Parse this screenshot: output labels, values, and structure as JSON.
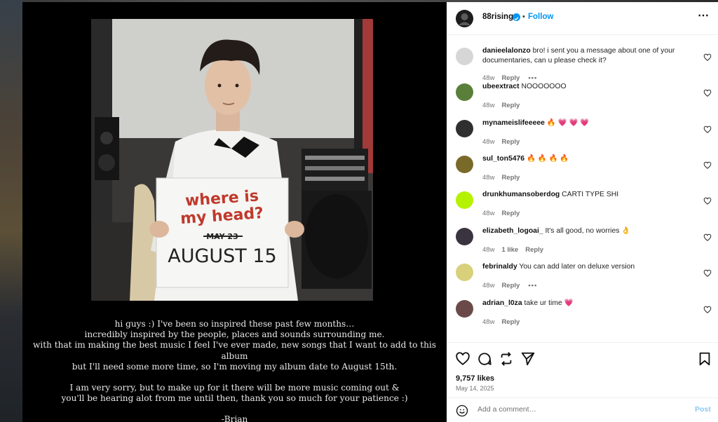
{
  "post": {
    "image_caption_lines": [
      "hi guys :) I've been so inspired these past few months…",
      "incredibly inspired by the people, places and sounds surrounding me.",
      "with that im making the best music I feel I've ever made, new songs that I want to add to this album",
      "but I'll need some more time, so I'm moving my album date to August 15th.",
      "",
      "I am very sorry, but to make up for it there will be more music coming out &",
      "you'll be hearing alot from me until then, thank you so much for your patience :)",
      "",
      "-Brian"
    ],
    "sign": {
      "title_line1": "where is",
      "title_line2": "my head?",
      "old_date": "MAY 23",
      "new_date": "AUGUST 15"
    }
  },
  "header": {
    "username": "88rising",
    "separator": "•",
    "follow_label": "Follow",
    "more_icon": "⋯"
  },
  "comments": [
    {
      "user": "danieelalonzo",
      "text": "bro! i sent you a message about one of your documentaries, can u please check it?",
      "time": "48w",
      "reply": "Reply",
      "likes": "",
      "more": "•••"
    },
    {
      "user": "ubeextract",
      "text": "NOOOOOOO",
      "time": "48w",
      "reply": "Reply",
      "likes": "",
      "more": ""
    },
    {
      "user": "mynameislifeeeee",
      "text": "🔥 💗 💗 💗",
      "time": "48w",
      "reply": "Reply",
      "likes": "",
      "more": ""
    },
    {
      "user": "sul_ton5476",
      "text": "🔥 🔥 🔥 🔥",
      "time": "48w",
      "reply": "Reply",
      "likes": "",
      "more": ""
    },
    {
      "user": "drunkhumansoberdog",
      "text": "CARTI TYPE SHI",
      "time": "48w",
      "reply": "Reply",
      "likes": "",
      "more": ""
    },
    {
      "user": "elizabeth_logoai_",
      "text": "It's all good, no worries 👌",
      "time": "48w",
      "reply": "Reply",
      "likes": "1 like",
      "more": ""
    },
    {
      "user": "febrinaldy",
      "text": "You can add later on deluxe version",
      "time": "48w",
      "reply": "Reply",
      "likes": "",
      "more": "•••"
    },
    {
      "user": "adrian_l0za",
      "text": "take ur time 💗",
      "time": "48w",
      "reply": "Reply",
      "likes": "",
      "more": ""
    }
  ],
  "engagement": {
    "likes": "9,757 likes",
    "date": "May 14, 2025"
  },
  "composer": {
    "placeholder": "Add a comment…",
    "post_label": "Post"
  },
  "colors": {
    "accent": "#0095f6",
    "post_disabled": "#8ac8f5",
    "sign_red": "#c0392b"
  }
}
